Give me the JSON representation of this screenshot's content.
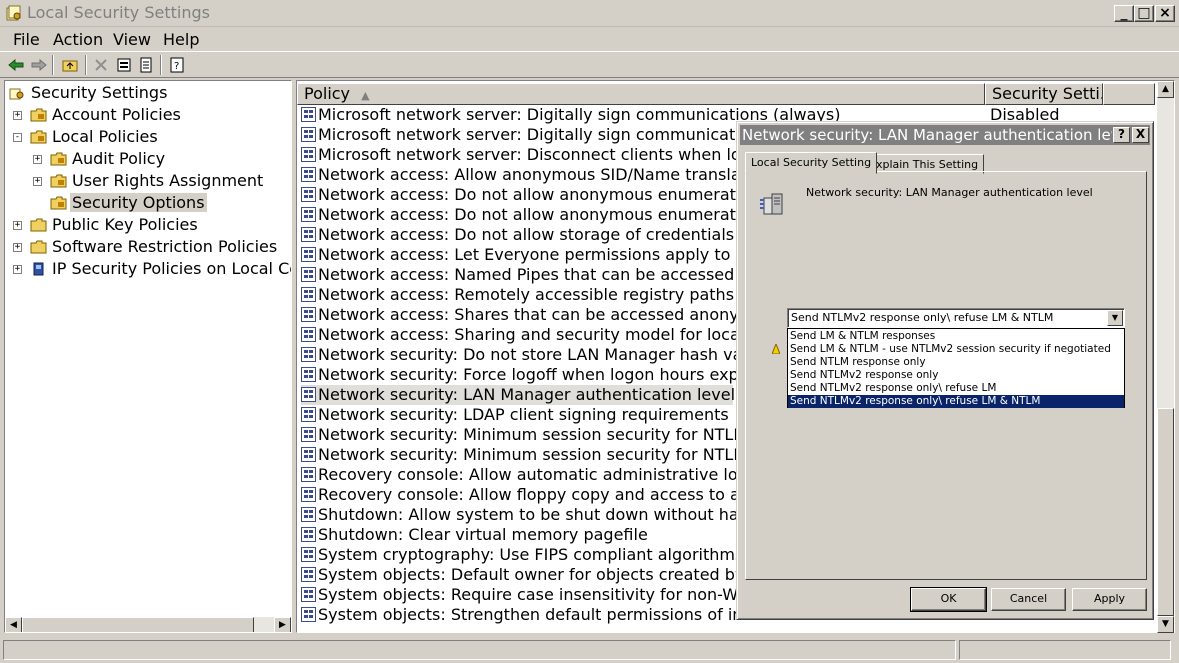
{
  "window": {
    "title": "Local Security Settings"
  },
  "menu": [
    "File",
    "Action",
    "View",
    "Help"
  ],
  "tree": {
    "root": "Security Settings",
    "items": [
      {
        "label": "Account Policies",
        "expander": "+"
      },
      {
        "label": "Local Policies",
        "expander": "-"
      },
      {
        "label": "Audit Policy",
        "expander": "+"
      },
      {
        "label": "User Rights Assignment",
        "expander": "+"
      },
      {
        "label": "Security Options",
        "expander": ""
      },
      {
        "label": "Public Key Policies",
        "expander": "+"
      },
      {
        "label": "Software Restriction Policies",
        "expander": "+"
      },
      {
        "label": "IP Security Policies on Local Compu",
        "expander": "+"
      }
    ]
  },
  "list": {
    "col_policy": "Policy",
    "col_setting": "Security Setti...",
    "rows": [
      {
        "policy": "Microsoft network server: Digitally sign communications (always)",
        "setting": "Disabled"
      },
      {
        "policy": "Microsoft network server: Digitally sign communications (if c",
        "setting": ""
      },
      {
        "policy": "Microsoft network server: Disconnect clients when logon hou",
        "setting": ""
      },
      {
        "policy": "Network access: Allow anonymous SID/Name translation",
        "setting": ""
      },
      {
        "policy": "Network access: Do not allow anonymous enumeration of SA",
        "setting": ""
      },
      {
        "policy": "Network access: Do not allow anonymous enumeration of SA",
        "setting": ""
      },
      {
        "policy": "Network access: Do not allow storage of credentials or .NET",
        "setting": ""
      },
      {
        "policy": "Network access: Let Everyone permissions apply to anonymo",
        "setting": ""
      },
      {
        "policy": "Network access: Named Pipes that can be accessed anonym",
        "setting": ""
      },
      {
        "policy": "Network access: Remotely accessible registry paths",
        "setting": ""
      },
      {
        "policy": "Network access: Shares that can be accessed anonymously",
        "setting": ""
      },
      {
        "policy": "Network access: Sharing and security model for local accour",
        "setting": ""
      },
      {
        "policy": "Network security: Do not store LAN Manager hash value on",
        "setting": ""
      },
      {
        "policy": "Network security: Force logoff when logon hours expire",
        "setting": ""
      },
      {
        "policy": "Network security: LAN Manager authentication level",
        "setting": ""
      },
      {
        "policy": "Network security: LDAP client signing requirements",
        "setting": ""
      },
      {
        "policy": "Network security: Minimum session security for NTLM SSP b",
        "setting": ""
      },
      {
        "policy": "Network security: Minimum session security for NTLM SSP b",
        "setting": ""
      },
      {
        "policy": "Recovery console: Allow automatic administrative logon",
        "setting": ""
      },
      {
        "policy": "Recovery console: Allow floppy copy and access to all drives",
        "setting": ""
      },
      {
        "policy": "Shutdown: Allow system to be shut down without having to",
        "setting": ""
      },
      {
        "policy": "Shutdown: Clear virtual memory pagefile",
        "setting": ""
      },
      {
        "policy": "System cryptography: Use FIPS compliant algorithms for enc",
        "setting": ""
      },
      {
        "policy": "System objects: Default owner for objects created by membe",
        "setting": ""
      },
      {
        "policy": "System objects: Require case insensitivity for non-Windows",
        "setting": ""
      },
      {
        "policy": "System objects: Strengthen default permissions of internal s",
        "setting": ""
      }
    ],
    "selected_index": 14
  },
  "dialog": {
    "title": "Network security: LAN Manager authentication level...",
    "help_label": "?",
    "close_label": "X",
    "tabs": [
      "Local Security Setting",
      "Explain This Setting"
    ],
    "heading": "Network security: LAN Manager authentication level",
    "selected_value": "Send NTLMv2 response only\\ refuse LM & NTLM",
    "options": [
      "Send LM & NTLM responses",
      "Send LM & NTLM - use NTLMv2 session security if negotiated",
      "Send NTLM response only",
      "Send NTLMv2 response only",
      "Send NTLMv2 response only\\ refuse LM",
      "Send NTLMv2 response only\\ refuse LM & NTLM"
    ],
    "selected_option_index": 5,
    "buttons": {
      "ok": "OK",
      "cancel": "Cancel",
      "apply": "Apply"
    }
  },
  "colors": {
    "chrome": "#d4d0c8",
    "selection": "#0a246a",
    "title_inactive": "#808080"
  }
}
